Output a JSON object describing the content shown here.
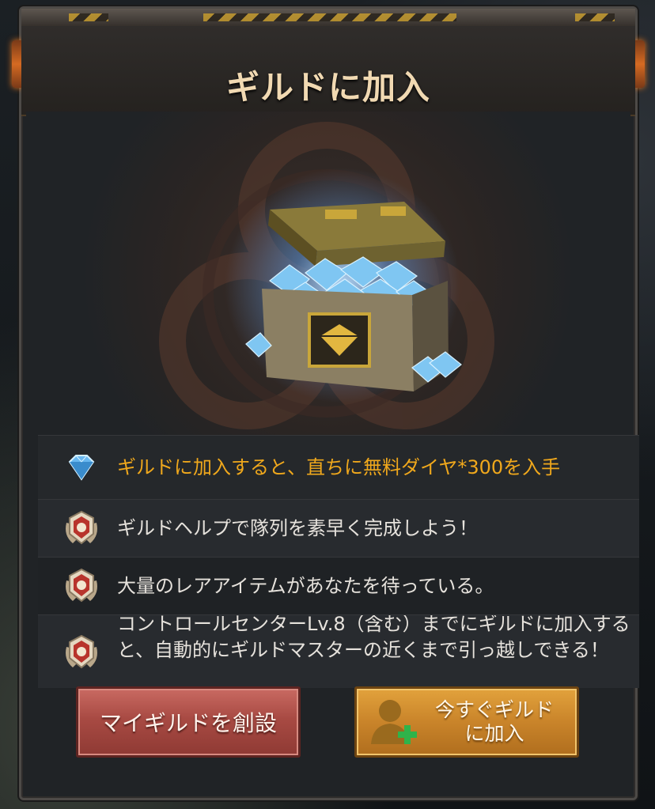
{
  "dialog": {
    "title": "ギルドに加入"
  },
  "features": [
    {
      "icon": "diamond-icon",
      "text": "ギルドに加入すると、直ちに無料ダイヤ*300を入手",
      "color": "#f0a81c"
    },
    {
      "icon": "medal-icon",
      "text": "ギルドヘルプで隊列を素早く完成しよう！"
    },
    {
      "icon": "medal-icon",
      "text": "大量のレアアイテムがあなたを待っている。"
    },
    {
      "icon": "medal-icon",
      "text": "コントロールセンターLv.8（含む）までにギルドに加入すると、自動的にギルドマスターの近くまで引っ越しできる！"
    }
  ],
  "buttons": {
    "create_label": "マイギルドを創設",
    "join_label": "今すぐギルドに加入"
  },
  "colors": {
    "accent_gold": "#f0a81c",
    "create_button": "#a84a43",
    "join_button": "#c9842a"
  }
}
